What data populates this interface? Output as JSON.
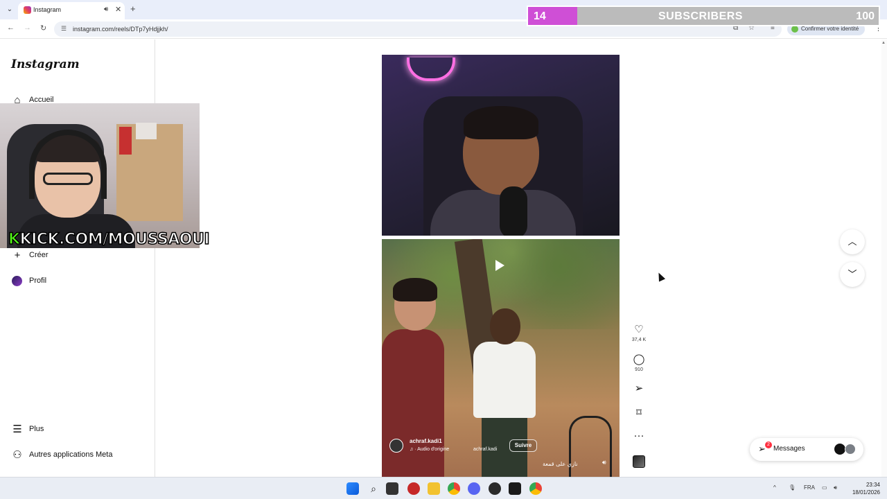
{
  "browser": {
    "tab_title": "Instagram",
    "url": "instagram.com/reels/DTp7yHdjjkh/",
    "identity_label": "Confirmer votre identité"
  },
  "overlay": {
    "subscriber_count": "14",
    "subscriber_label": "SUBSCRIBERS",
    "subscriber_goal": "100",
    "subscriber_progress": 0.14,
    "kick_prefix": "K",
    "kick_text": "KICK.COM/MOUSSAOUI"
  },
  "sidebar": {
    "logo": "Instagram",
    "items": [
      {
        "label": "Accueil",
        "icon": "home-icon"
      },
      {
        "label": "Créer",
        "icon": "plus-icon"
      },
      {
        "label": "Profil",
        "icon": "avatar"
      }
    ],
    "bottom_items": [
      {
        "label": "Plus",
        "icon": "menu-icon"
      },
      {
        "label": "Autres applications Meta",
        "icon": "meta-apps-icon"
      }
    ]
  },
  "reel": {
    "author": "achraf.kadi1",
    "audio": "· Audio d'origine",
    "audio_user": "achraf.kadi",
    "follow_label": "Suivre",
    "caption": "نازي على قمعة",
    "likes": "37,4 K",
    "comments": "910"
  },
  "messages": {
    "label": "Messages",
    "badge": "2"
  },
  "taskbar": {
    "language": "FRA",
    "time": "23:34",
    "date": "18/01/2026"
  },
  "colors": {
    "subscriber_fill": "#cf4fd6",
    "kick_green": "#53fc18"
  }
}
